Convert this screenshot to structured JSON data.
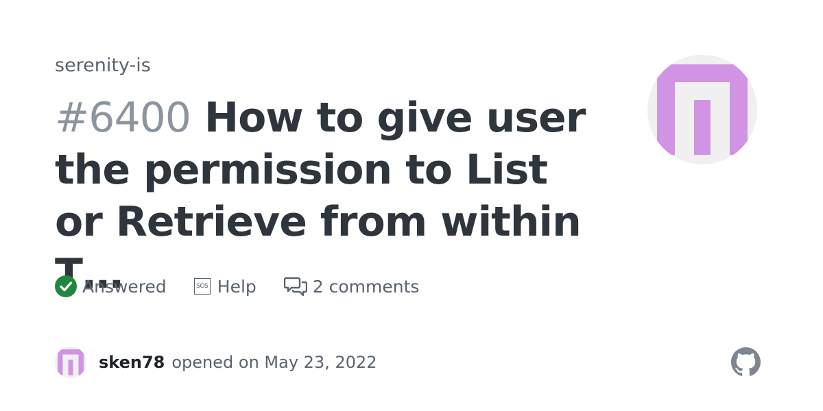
{
  "repo": {
    "owner": "serenity-is"
  },
  "issue": {
    "number": "#6400",
    "title": "How to give user the permission to List or Retrieve from within T…"
  },
  "meta": {
    "status": "Answered",
    "category": "Help",
    "comments": "2 comments"
  },
  "footer": {
    "author": "sken78",
    "opened_text": "opened on May 23, 2022"
  },
  "icons": {
    "status": "check-circle-icon",
    "category": "sos-icon",
    "comments": "comment-discussion-icon",
    "brand": "github-mark-icon"
  },
  "colors": {
    "title": "#2f353d",
    "number": "#8c959f",
    "muted": "#59636e",
    "success": "#1f883d",
    "avatar_pink": "#d193e4",
    "avatar_bg": "#f0f0f0",
    "github_logo": "#7d8590"
  }
}
